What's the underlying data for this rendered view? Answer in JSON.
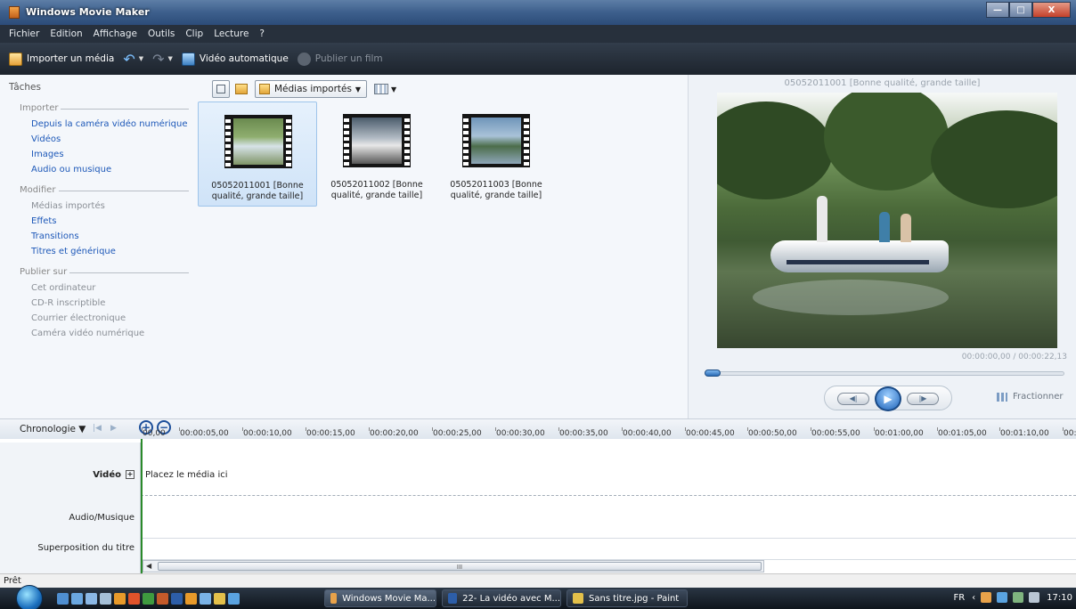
{
  "window": {
    "title": "Windows Movie Maker",
    "minimize": "—",
    "maximize": "□",
    "close": "X"
  },
  "menu": [
    "Fichier",
    "Edition",
    "Affichage",
    "Outils",
    "Clip",
    "Lecture",
    "?"
  ],
  "toolbar": {
    "import": "Importer un média",
    "auto_movie": "Vidéo automatique",
    "publish": "Publier un film"
  },
  "tasks": {
    "title": "Tâches",
    "import_section": "Importer",
    "import_links": [
      "Depuis la caméra vidéo numérique",
      "Vidéos",
      "Images",
      "Audio ou musique"
    ],
    "edit_section": "Modifier",
    "edit_links": [
      "Médias importés",
      "Effets",
      "Transitions",
      "Titres et générique"
    ],
    "publish_section": "Publier sur",
    "publish_links": [
      "Cet ordinateur",
      "CD-R inscriptible",
      "Courrier électronique",
      "Caméra vidéo numérique"
    ]
  },
  "collections": {
    "dropdown": "Médias importés",
    "clips": [
      {
        "line1": "05052011001 [Bonne",
        "line2": "qualité, grande taille]"
      },
      {
        "line1": "05052011002 [Bonne",
        "line2": "qualité, grande taille]"
      },
      {
        "line1": "05052011003 [Bonne",
        "line2": "qualité, grande taille]"
      }
    ]
  },
  "preview": {
    "title": "05052011001 [Bonne qualité, grande taille]",
    "timecode": "00:00:00,00 / 00:00:22,13",
    "split": "Fractionner",
    "progress": 0.0
  },
  "timeline": {
    "mode": "Chronologie",
    "ticks": [
      "00,00",
      "00:00:05,00",
      "00:00:10,00",
      "00:00:15,00",
      "00:00:20,00",
      "00:00:25,00",
      "00:00:30,00",
      "00:00:35,00",
      "00:00:40,00",
      "00:00:45,00",
      "00:00:50,00",
      "00:00:55,00",
      "00:01:00,00",
      "00:01:05,00",
      "00:01:10,00",
      "00:0"
    ],
    "tracks": {
      "video": "Vidéo",
      "audio": "Audio/Musique",
      "title": "Superposition du titre"
    },
    "drop_hint": "Placez le média ici",
    "scroll_mark": "III"
  },
  "status": "Prêt",
  "taskbar": {
    "tasks": [
      "Windows Movie Ma...",
      "22- La vidéo avec M...",
      "Sans titre.jpg - Paint"
    ],
    "lang": "FR",
    "time": "17:10"
  }
}
